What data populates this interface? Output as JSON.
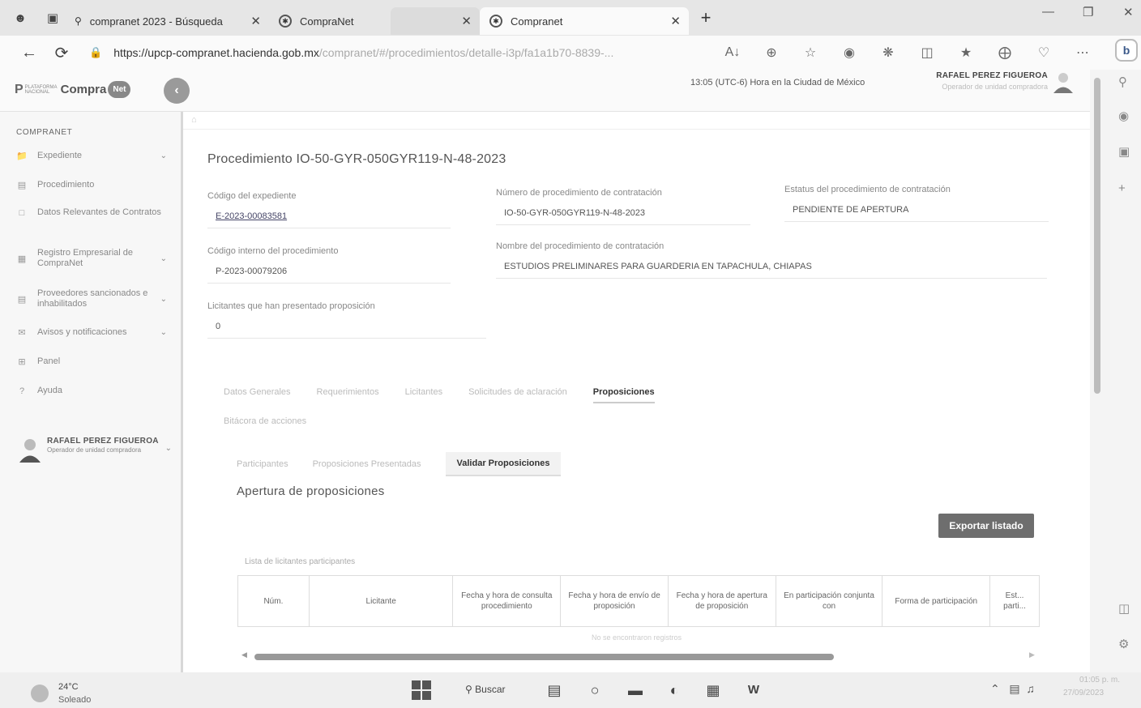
{
  "browser": {
    "tabs": [
      {
        "label": "compranet 2023 - Búsqueda"
      },
      {
        "label": "CompraNet"
      },
      {
        "label": ""
      },
      {
        "label": "Compranet"
      }
    ],
    "url_host": "https://upcp-compranet.hacienda.gob.mx",
    "url_path": "/compranet/#/procedimientos/detalle-i3p/fa1a1b70-8839-..."
  },
  "header": {
    "logo_pn": "P",
    "logo_small": "PLATAFORMA NACIONAL",
    "logo_name": "Compra",
    "logo_badge": "Net",
    "clock": "13:05 (UTC-6) Hora en la Ciudad de México",
    "user_name": "RAFAEL PEREZ FIGUEROA",
    "user_role": "Operador de unidad compradora"
  },
  "sidebar": {
    "title": "COMPRANET",
    "items": [
      {
        "label": "Expediente"
      },
      {
        "label": "Procedimiento"
      },
      {
        "label": "Datos Relevantes de Contratos"
      },
      {
        "label": "Registro Empresarial de CompraNet"
      },
      {
        "label": "Proveedores sancionados e inhabilitados"
      },
      {
        "label": "Avisos y notificaciones"
      },
      {
        "label": "Panel"
      },
      {
        "label": "Ayuda"
      }
    ],
    "user_name": "RAFAEL PEREZ FIGUEROA",
    "user_role": "Operador de unidad compradora"
  },
  "procedure": {
    "title": "Procedimiento IO-50-GYR-050GYR119-N-48-2023",
    "fields": {
      "expediente_label": "Código del expediente",
      "expediente_value": "E-2023-00083581",
      "numero_label": "Número de procedimiento de contratación",
      "numero_value": "IO-50-GYR-050GYR119-N-48-2023",
      "estatus_label": "Estatus del procedimiento de contratación",
      "estatus_value": "PENDIENTE DE APERTURA",
      "codigo_interno_label": "Código interno del procedimiento",
      "codigo_interno_value": "P-2023-00079206",
      "nombre_label": "Nombre del procedimiento de contratación",
      "nombre_value": "ESTUDIOS PRELIMINARES PARA GUARDERIA EN TAPACHULA, CHIAPAS",
      "licitantes_label": "Licitantes que han presentado proposición",
      "licitantes_value": "0"
    }
  },
  "tabs_main": [
    {
      "label": "Datos Generales"
    },
    {
      "label": "Requerimientos"
    },
    {
      "label": "Licitantes"
    },
    {
      "label": "Solicitudes de aclaración"
    },
    {
      "label": "Proposiciones"
    }
  ],
  "tab_bitacora": "Bitácora de acciones",
  "tabs_sub": [
    {
      "label": "Participantes"
    },
    {
      "label": "Proposiciones Presentadas"
    },
    {
      "label": "Validar Proposiciones"
    }
  ],
  "apertura": {
    "title": "Apertura de proposiciones",
    "export_label": "Exportar listado",
    "list_label": "Lista de licitantes participantes",
    "columns": [
      "Núm.",
      "Licitante",
      "Fecha y hora de consulta procedimiento",
      "Fecha y hora de envío de proposición",
      "Fecha y hora de apertura de proposición",
      "En participación conjunta con",
      "Forma de participación",
      "Est... parti..."
    ],
    "empty_message": "No se encontraron registros"
  },
  "taskbar": {
    "temp": "24°C",
    "weather": "Soleado",
    "search": "Buscar",
    "time": "01:05 p. m.",
    "date": "27/09/2023"
  }
}
